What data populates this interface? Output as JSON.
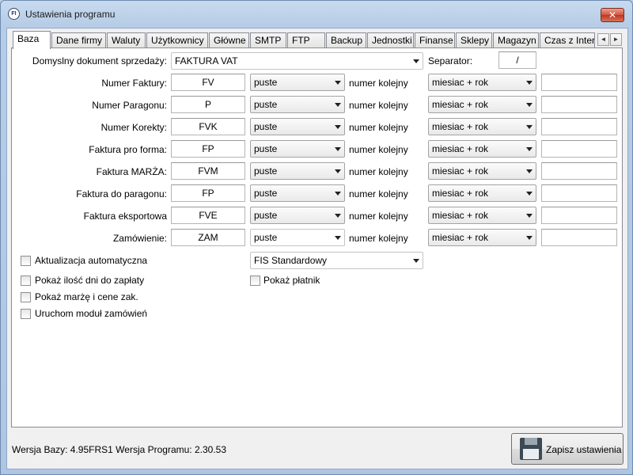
{
  "window": {
    "title": "Ustawienia programu",
    "close_label": "✕",
    "app_icon": "FI"
  },
  "tabs": [
    {
      "label": "Baza"
    },
    {
      "label": "Dane firmy"
    },
    {
      "label": "Waluty"
    },
    {
      "label": "Użytkownicy"
    },
    {
      "label": "Główne"
    },
    {
      "label": "SMTP"
    },
    {
      "label": "FTP"
    },
    {
      "label": "Backup"
    },
    {
      "label": "Jednostki"
    },
    {
      "label": "Finanse"
    },
    {
      "label": "Sklepy"
    },
    {
      "label": "Magazyn"
    },
    {
      "label": "Czas z Intern"
    }
  ],
  "tab_scroll": {
    "left": "◄",
    "right": "►"
  },
  "default_doc": {
    "label": "Domyslny dokument sprzedaży:",
    "value": "FAKTURA VAT",
    "separator_label": "Separator:",
    "separator_value": "/"
  },
  "numbering_rows": [
    {
      "label": "Numer Faktury:",
      "prefix": "FV",
      "mode": "puste",
      "counter": "numer kolejny",
      "period": "miesiac + rok",
      "extra": ""
    },
    {
      "label": "Numer Paragonu:",
      "prefix": "P",
      "mode": "puste",
      "counter": "numer kolejny",
      "period": "miesiac + rok",
      "extra": ""
    },
    {
      "label": "Numer Korekty:",
      "prefix": "FVK",
      "mode": "puste",
      "counter": "numer kolejny",
      "period": "miesiac + rok",
      "extra": ""
    },
    {
      "label": "Faktura pro forma:",
      "prefix": "FP",
      "mode": "puste",
      "counter": "numer kolejny",
      "period": "miesiac + rok",
      "extra": ""
    },
    {
      "label": "Faktura MARŻA:",
      "prefix": "FVM",
      "mode": "puste",
      "counter": "numer kolejny",
      "period": "miesiac + rok",
      "extra": ""
    },
    {
      "label": "Faktura do paragonu:",
      "prefix": "FP",
      "mode": "puste",
      "counter": "numer kolejny",
      "period": "miesiac + rok",
      "extra": ""
    },
    {
      "label": "Faktura eksportowa",
      "prefix": "FVE",
      "mode": "puste",
      "counter": "numer kolejny",
      "period": "miesiac + rok",
      "extra": ""
    },
    {
      "label": "Zamówienie:",
      "prefix": "ZAM",
      "mode": "puste",
      "counter": "numer kolejny",
      "period": "miesiac + rok",
      "extra": ""
    }
  ],
  "checkboxes": {
    "auto_update": {
      "label": "Aktualizacja automatyczna",
      "checked": false
    },
    "show_days": {
      "label": "Pokaż ilość dni do zapłaty",
      "checked": false
    },
    "show_margin": {
      "label": "Pokaż marżę i cene zak.",
      "checked": false
    },
    "order_module": {
      "label": "Uruchom moduł zamówień",
      "checked": false
    },
    "show_payer": {
      "label": "Pokaż płatnik",
      "checked": false
    }
  },
  "print_template": {
    "value": "FIS Standardowy"
  },
  "footer": {
    "version_text": "Wersja Bazy: 4.95FRS1 Wersja Programu: 2.30.53",
    "save_label": "Zapisz ustawienia",
    "save_icon": "floppy-disk-icon"
  }
}
